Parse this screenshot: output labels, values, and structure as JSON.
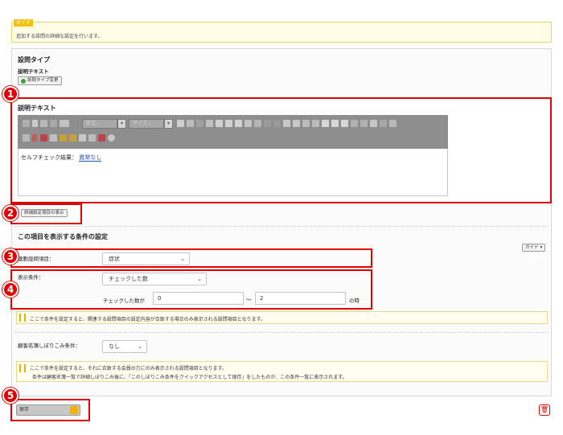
{
  "guide": {
    "tag": "ガイド",
    "text": "追加する設問の詳細な設定を行います。"
  },
  "question_type": {
    "title": "設問タイプ",
    "value": "説明テキスト",
    "change_button": "設問タイプ変更"
  },
  "description": {
    "title": "説明テキスト",
    "toolbar": {
      "format_placeholder": "形式...",
      "size_placeholder": "サイズ..."
    },
    "body_label": "セルフチェック結果：",
    "body_value": "異常なし"
  },
  "detail_toggle": {
    "label": "詳細設定項目の表示"
  },
  "conditions": {
    "title": "この項目を表示する条件の設定",
    "guide_button": "ガイド",
    "linked_question": {
      "label": "連動設問項目：",
      "value": "症状"
    },
    "display_condition": {
      "label": "表示条件：",
      "value": "チェックした数",
      "count_label": "チェックした数が",
      "min_value": "0",
      "range_sep": "～",
      "max_value": "2",
      "unit": "の時"
    },
    "note1": "ここで条件を設定すると、関連する設問項目の設定内容が合致する場合のみ表示される設問項目となります。",
    "customer_filter": {
      "label": "顧客名簿しぼりこみ条件：",
      "value": "なし"
    },
    "note2_line1": "ここで条件を設定すると、それに合致する会員の方にのみ表示される設問項目となります。",
    "note2_line2": "条件は顧客名簿一覧で詳細しぼりこみ後に、「このしぼりこみ条件をクイックアクセスとして保存」をしたものが、この条件一覧に表示されます。"
  },
  "footer": {
    "save_label": "保存"
  },
  "callouts": [
    "1",
    "2",
    "3",
    "4",
    "5"
  ],
  "colors": {
    "callout_red": "#e00000",
    "toolbar_gray": "#8e8e8e",
    "guide_yellow": "#f2c200",
    "link_blue": "#1f4fb0"
  },
  "icons": [
    "caution-icon",
    "lock-icon",
    "trash-icon",
    "add-icon",
    "chevron-down-icon",
    "editor-toolbar-icons"
  ]
}
